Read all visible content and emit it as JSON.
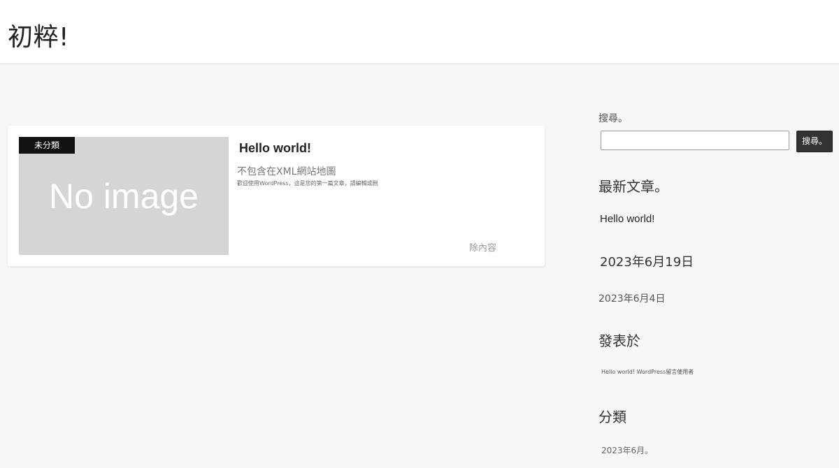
{
  "header": {
    "site_title": "初粹!"
  },
  "post": {
    "category_badge": "未分類",
    "thumbnail_text": "No image",
    "title": "Hello world!",
    "note": "不包含在XML網站地圖",
    "excerpt": "歡迎使用WordPress，這是您的第一篇文章，請編輯或刪",
    "read_more": "除內容"
  },
  "sidebar": {
    "search": {
      "label": "搜尋。",
      "placeholder": "",
      "button_label": "搜尋。"
    },
    "recent_posts": {
      "title": "最新文章。",
      "items": [
        "Hello world!"
      ]
    },
    "dates": {
      "primary": "2023年6月19日",
      "secondary": "2023年6月4日"
    },
    "comments": {
      "title": "發表於",
      "line": "Hello world! WordPress留言使用者"
    },
    "categories": {
      "title": "分類",
      "archive_item": "2023年6月。"
    }
  }
}
